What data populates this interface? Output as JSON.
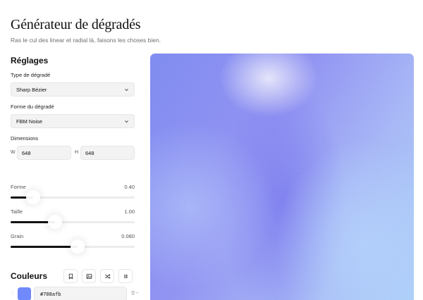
{
  "header": {
    "title": "Générateur de dégradés",
    "subtitle": "Ras le cul des linear et radial là, faisons les choses bien."
  },
  "settings": {
    "title": "Réglages",
    "gradient_type": {
      "label": "Type de dégradé",
      "value": "Sharp Bézier"
    },
    "gradient_shape": {
      "label": "Forme du dégradé",
      "value": "FBM Noise"
    },
    "dimensions": {
      "label": "Dimensions",
      "w_prefix": "W",
      "w_value": "648",
      "h_prefix": "H",
      "h_value": "648"
    },
    "sliders": [
      {
        "label": "Forme",
        "value_text": "0.40",
        "fraction": 0.18
      },
      {
        "label": "Taille",
        "value_text": "1.00",
        "fraction": 0.36
      },
      {
        "label": "Grain",
        "value_text": "0.080",
        "fraction": 0.54
      }
    ]
  },
  "colors": {
    "title": "Couleurs",
    "actions": [
      "bookmark-icon",
      "image-icon",
      "shuffle-icon",
      "pause-icon"
    ],
    "items": [
      {
        "hex": "#708afb",
        "swatch": "#708afb"
      }
    ]
  },
  "theme": {
    "accent": "#708afb",
    "text": "#111111",
    "muted": "#6f6f6f",
    "input_bg": "#f3f3f3"
  }
}
